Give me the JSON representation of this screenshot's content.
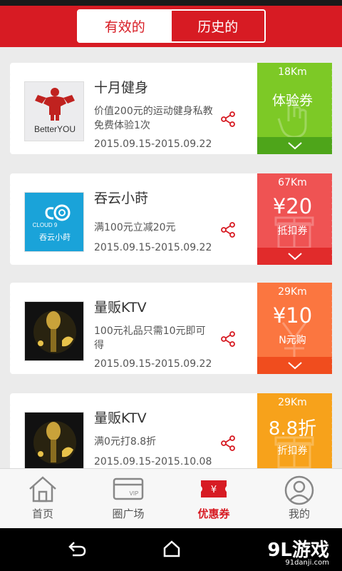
{
  "header": {
    "tabs": [
      {
        "label": "有效的",
        "active": true
      },
      {
        "label": "历史的",
        "active": false
      }
    ]
  },
  "coupons": [
    {
      "logo": "betteryou-logo",
      "logo_text": "BetterYOU",
      "title": "十月健身",
      "description": "价值200元的运动健身私教免费体验1次",
      "date_range": "2015.09.15-2015.09.22",
      "distance": "18Km",
      "value": "体验券",
      "type_label": "",
      "color": "#7dc926",
      "footer_color": "#4ea51a"
    },
    {
      "logo": "cloud9-logo",
      "logo_text_top": "CLOUD 9",
      "logo_text_bottom": "吞云小莳",
      "title": "吞云小莳",
      "description": "满100元立减20元",
      "date_range": "2015.09.15-2015.09.22",
      "distance": "67Km",
      "value": "¥20",
      "type_label": "抵扣券",
      "color": "#ef5353",
      "footer_color": "#e12b2b"
    },
    {
      "logo": "ktv-logo",
      "title": "量贩KTV",
      "description": "100元礼品只需10元即可得",
      "date_range": "2015.09.15-2015.09.22",
      "distance": "29Km",
      "value": "¥10",
      "type_label": "N元购",
      "color": "#fb7640",
      "footer_color": "#f04d1e"
    },
    {
      "logo": "ktv-logo",
      "title": "量贩KTV",
      "description": "满0元打8.8折",
      "date_range": "2015.09.15-2015.10.08",
      "distance": "29Km",
      "value": "8.8折",
      "type_label": "折扣券",
      "color": "#f7a21b",
      "footer_color": "#ef8a10"
    }
  ],
  "tabbar": [
    {
      "label": "首页",
      "icon": "home-icon",
      "active": false
    },
    {
      "label": "圈广场",
      "icon": "vip-card-icon",
      "active": false
    },
    {
      "label": "优惠券",
      "icon": "coupon-ticket-icon",
      "active": true
    },
    {
      "label": "我的",
      "icon": "user-profile-icon",
      "active": false
    }
  ],
  "watermark": {
    "main": "9L游戏",
    "sub": "91danji.com"
  },
  "theme": {
    "primary": "#d71b23",
    "background": "#ebebeb"
  }
}
